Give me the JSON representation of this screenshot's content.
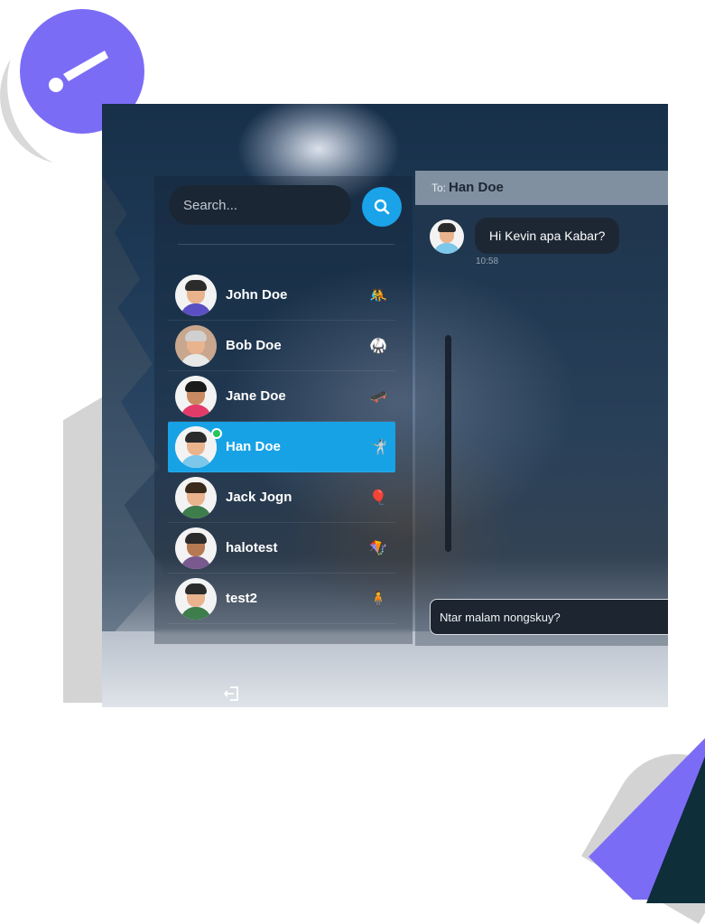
{
  "search": {
    "placeholder": "Search..."
  },
  "contacts": [
    {
      "name": "John Doe",
      "emoji": "🤼",
      "active": false
    },
    {
      "name": "Bob Doe",
      "emoji": "🥋",
      "active": false
    },
    {
      "name": "Jane Doe",
      "emoji": "🛹",
      "active": false
    },
    {
      "name": "Han Doe",
      "emoji": "🤺",
      "active": true,
      "online": true
    },
    {
      "name": "Jack Jogn",
      "emoji": "🎈",
      "active": false
    },
    {
      "name": "halotest",
      "emoji": "🪁",
      "active": false
    },
    {
      "name": "test2",
      "emoji": "🧍",
      "active": false
    }
  ],
  "chat": {
    "to_label": "To:",
    "to_name": "Han Doe",
    "messages": [
      {
        "text": "Hi Kevin apa Kabar?",
        "time": "10:58"
      }
    ],
    "input_value": "Ntar malam nongskuy?"
  },
  "colors": {
    "accent": "#17a2e6",
    "badge": "#7b6cf6",
    "online": "#27c55a"
  },
  "icons": {
    "badge": "brush-icon",
    "search": "search-icon",
    "logout": "logout-icon"
  }
}
